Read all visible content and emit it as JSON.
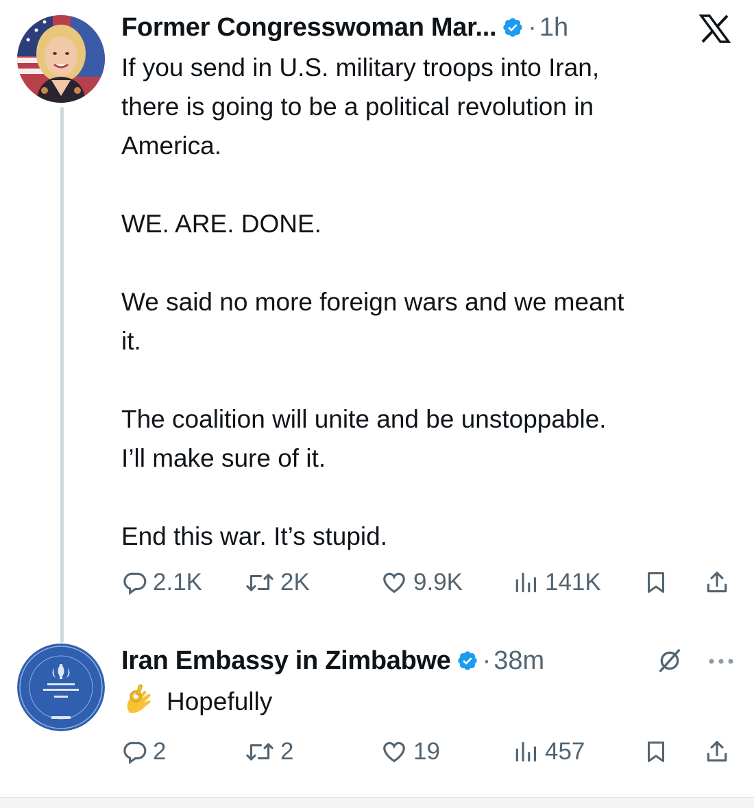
{
  "post": {
    "author_name": "Former Congresswoman Mar...",
    "separator": "·",
    "time": "1h",
    "text": "If you send in U.S. military troops into Iran,\nthere is going to be a political revolution in\nAmerica.\n\nWE. ARE. DONE.\n\nWe said no more foreign wars and we meant\nit.\n\nThe coalition will unite and be unstoppable.\nI’ll make sure of it.\n\nEnd this war. It’s stupid.",
    "replies": "2.1K",
    "reposts": "2K",
    "likes": "9.9K",
    "views": "141K"
  },
  "reply": {
    "author_name": "Iran Embassy in Zimbabwe",
    "separator": "·",
    "time": "38m",
    "emoji": "ok-hand-emoji",
    "text": "Hopefully",
    "replies": "2",
    "reposts": "2",
    "likes": "19",
    "views": "457"
  },
  "icons": {
    "logo": "x-logo-icon",
    "verified": "verified-badge-icon",
    "grok": "grok-icon",
    "more": "more-icon",
    "reply": "reply-icon",
    "repost": "repost-icon",
    "like": "like-icon",
    "views": "views-icon",
    "bookmark": "bookmark-icon",
    "share": "share-icon"
  },
  "colors": {
    "verified_blue": "#1d9bf0",
    "secondary_text": "#536471",
    "primary_text": "#0f1419",
    "thread_line": "#cfd9de"
  }
}
